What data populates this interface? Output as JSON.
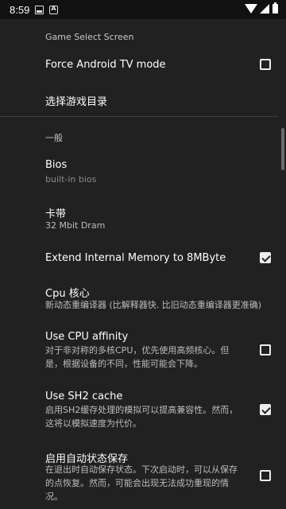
{
  "status_bar": {
    "time": "8:59"
  },
  "sections": {
    "game_select": {
      "header": "Game Select Screen"
    },
    "general": {
      "header": "一般"
    }
  },
  "settings": {
    "force_tv": {
      "title": "Force Android TV mode",
      "checked": false
    },
    "game_dir": {
      "title": "选择游戏目录"
    },
    "bios": {
      "title": "Bios",
      "summary": "built-in bios"
    },
    "cartridge": {
      "title": "卡带",
      "summary": "32 Mbit Dram"
    },
    "extend_memory": {
      "title": "Extend Internal Memory to 8MByte",
      "checked": true
    },
    "cpu_core": {
      "title": "Cpu 核心",
      "summary": "新动态重编译器 (比解释器快. 比旧动态重编译器更准确)"
    },
    "cpu_affinity": {
      "title": "Use CPU affinity",
      "summary_line1": "对于非对称的多核CPU，优先使用高频核心。但",
      "summary_line2": "是，根据设备的不同，性能可能会下降。",
      "checked": false
    },
    "sh2_cache": {
      "title": "Use SH2 cache",
      "summary_line1": "启用SH2缓存处理的模拟可以提高兼容性。然而，",
      "summary_line2": "这将以模拟速度为代价。",
      "checked": true
    },
    "auto_save": {
      "title": "启用自动状态保存",
      "summary_line1": "在退出时自动保存状态。下次启动时，可以从保存",
      "summary_line2": "的点恢复。然而，可能会出现无法成功重现的情",
      "summary_line3": "况。",
      "checked": false
    }
  },
  "colors": {
    "background": "#212121",
    "status_bar": "#111111",
    "text": "#ffffff"
  }
}
